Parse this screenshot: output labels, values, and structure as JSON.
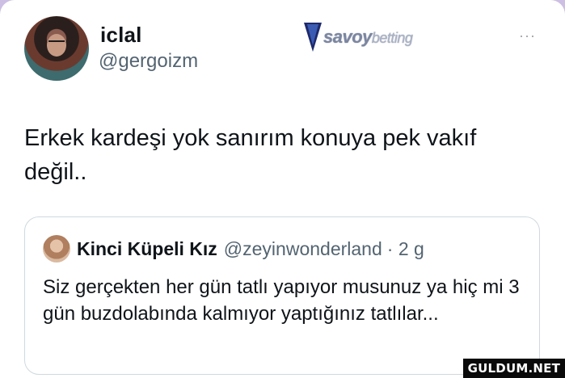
{
  "author": {
    "name": "iclal",
    "handle": "@gergoizm"
  },
  "watermark": {
    "brand_main": "savoy",
    "brand_suffix": "betting"
  },
  "more_menu": {
    "label": "···"
  },
  "tweet": {
    "text": "Erkek kardeşi yok sanırım konuya pek vakıf değil.."
  },
  "quoted_tweet": {
    "author_name": "Kinci Küpeli Kız",
    "author_handle": "@zeyinwonderland",
    "age": "· 2 g",
    "text": "Siz gerçekten her gün tatlı yapıyor musunuz ya hiç mi 3 gün buzdolabında kalmıyor yaptığınız tatlılar..."
  },
  "site_mark": {
    "text": "GULDUM.NET"
  }
}
